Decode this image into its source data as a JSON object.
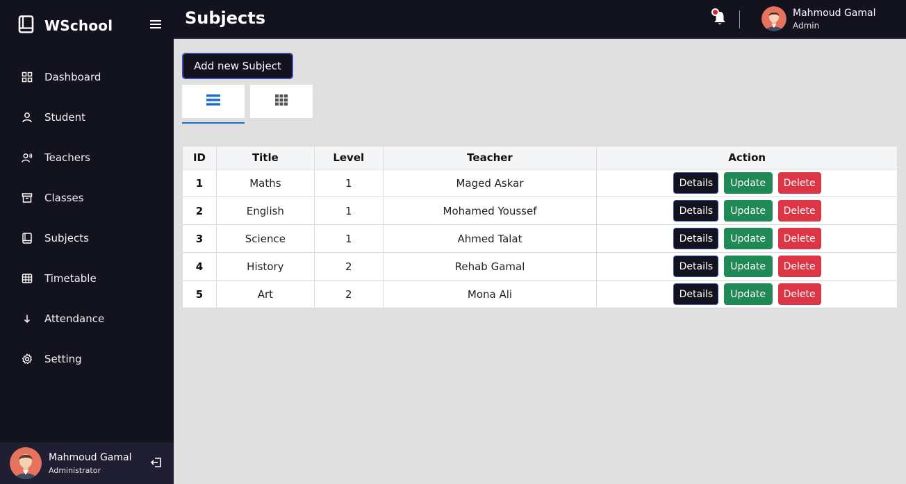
{
  "app": {
    "name": "WSchool"
  },
  "sidebar": {
    "items": [
      {
        "label": "Dashboard",
        "icon": "dashboard-icon"
      },
      {
        "label": "Student",
        "icon": "user-icon"
      },
      {
        "label": "Teachers",
        "icon": "teacher-icon"
      },
      {
        "label": "Classes",
        "icon": "archive-icon"
      },
      {
        "label": "Subjects",
        "icon": "book-icon"
      },
      {
        "label": "Timetable",
        "icon": "table-icon"
      },
      {
        "label": "Attendance",
        "icon": "arrow-down-icon"
      },
      {
        "label": "Setting",
        "icon": "gear-icon"
      }
    ],
    "footer_user": {
      "name": "Mahmoud Gamal",
      "role": "Administrator"
    }
  },
  "header": {
    "title": "Subjects",
    "user": {
      "name": "Mahmoud Gamal",
      "role": "Admin"
    }
  },
  "main": {
    "add_button": "Add new Subject",
    "table": {
      "columns": [
        "ID",
        "Title",
        "Level",
        "Teacher",
        "Action"
      ],
      "rows": [
        {
          "id": "1",
          "title": "Maths",
          "level": "1",
          "teacher": "Maged Askar"
        },
        {
          "id": "2",
          "title": "English",
          "level": "1",
          "teacher": "Mohamed Youssef"
        },
        {
          "id": "3",
          "title": "Science",
          "level": "1",
          "teacher": "Ahmed Talat"
        },
        {
          "id": "4",
          "title": "History",
          "level": "2",
          "teacher": "Rehab Gamal"
        },
        {
          "id": "5",
          "title": "Art",
          "level": "2",
          "teacher": "Mona Ali"
        }
      ],
      "action_labels": {
        "details": "Details",
        "update": "Update",
        "delete": "Delete"
      }
    }
  },
  "colors": {
    "sidebar_bg": "#13121f",
    "content_bg": "#e0e0e0",
    "update_green": "#1f8a55",
    "delete_red": "#dc3545",
    "active_tab": "#1c6fc7"
  }
}
